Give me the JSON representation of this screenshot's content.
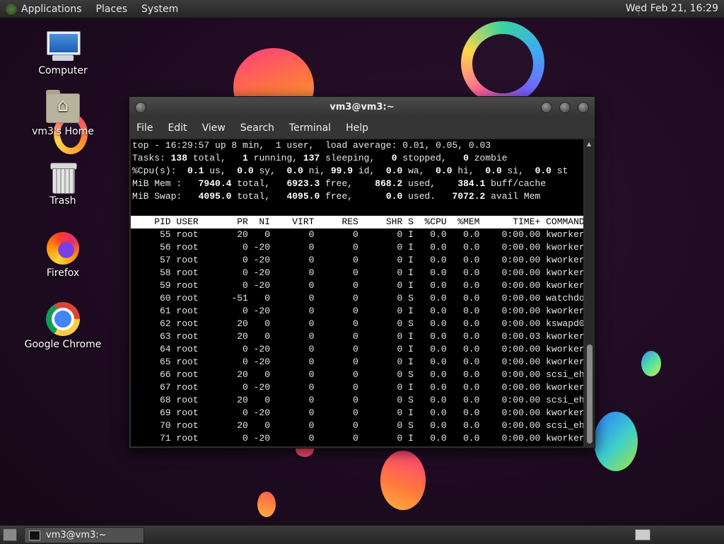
{
  "top_panel": {
    "menus": [
      "Applications",
      "Places",
      "System"
    ],
    "clock": "Wed Feb 21, 16:29"
  },
  "desktop_icons": [
    {
      "label": "Computer",
      "icon": "computer-icon"
    },
    {
      "label": "vm3's Home",
      "icon": "home-folder-icon"
    },
    {
      "label": "Trash",
      "icon": "trash-icon"
    },
    {
      "label": "Firefox",
      "icon": "firefox-icon"
    },
    {
      "label": "Google Chrome",
      "icon": "chrome-icon"
    }
  ],
  "window": {
    "title": "vm3@vm3:~",
    "menu": [
      "File",
      "Edit",
      "View",
      "Search",
      "Terminal",
      "Help"
    ]
  },
  "top": {
    "summary": [
      "top - 16:29:57 up 8 min,  1 user,  load average: 0.01, 0.05, 0.03",
      "Tasks: 138 total,   1 running, 137 sleeping,   0 stopped,   0 zombie",
      "%Cpu(s):  0.1 us,  0.0 sy,  0.0 ni, 99.9 id,  0.0 wa,  0.0 hi,  0.0 si,  0.0 st",
      "MiB Mem :   7940.4 total,   6923.3 free,    868.2 used,    384.1 buff/cache",
      "MiB Swap:   4095.0 total,   4095.0 free,      0.0 used.   7072.2 avail Mem"
    ],
    "columns": [
      "PID",
      "USER",
      "PR",
      "NI",
      "VIRT",
      "RES",
      "SHR",
      "S",
      "%CPU",
      "%MEM",
      "TIME+",
      "COMMAND"
    ],
    "processes": [
      [
        "55",
        "root",
        "20",
        "0",
        "0",
        "0",
        "0",
        "I",
        "0.0",
        "0.0",
        "0:00.00",
        "kworker+"
      ],
      [
        "56",
        "root",
        "0",
        "-20",
        "0",
        "0",
        "0",
        "I",
        "0.0",
        "0.0",
        "0:00.00",
        "kworker+"
      ],
      [
        "57",
        "root",
        "0",
        "-20",
        "0",
        "0",
        "0",
        "I",
        "0.0",
        "0.0",
        "0:00.00",
        "kworker+"
      ],
      [
        "58",
        "root",
        "0",
        "-20",
        "0",
        "0",
        "0",
        "I",
        "0.0",
        "0.0",
        "0:00.00",
        "kworker+"
      ],
      [
        "59",
        "root",
        "0",
        "-20",
        "0",
        "0",
        "0",
        "I",
        "0.0",
        "0.0",
        "0:00.00",
        "kworker+"
      ],
      [
        "60",
        "root",
        "-51",
        "0",
        "0",
        "0",
        "0",
        "S",
        "0.0",
        "0.0",
        "0:00.00",
        "watchdo+"
      ],
      [
        "61",
        "root",
        "0",
        "-20",
        "0",
        "0",
        "0",
        "I",
        "0.0",
        "0.0",
        "0:00.00",
        "kworker+"
      ],
      [
        "62",
        "root",
        "20",
        "0",
        "0",
        "0",
        "0",
        "S",
        "0.0",
        "0.0",
        "0:00.00",
        "kswapd0"
      ],
      [
        "63",
        "root",
        "20",
        "0",
        "0",
        "0",
        "0",
        "I",
        "0.0",
        "0.0",
        "0:00.03",
        "kworker+"
      ],
      [
        "64",
        "root",
        "0",
        "-20",
        "0",
        "0",
        "0",
        "I",
        "0.0",
        "0.0",
        "0:00.00",
        "kworker+"
      ],
      [
        "65",
        "root",
        "0",
        "-20",
        "0",
        "0",
        "0",
        "I",
        "0.0",
        "0.0",
        "0:00.00",
        "kworker+"
      ],
      [
        "66",
        "root",
        "20",
        "0",
        "0",
        "0",
        "0",
        "S",
        "0.0",
        "0.0",
        "0:00.00",
        "scsi_eh+"
      ],
      [
        "67",
        "root",
        "0",
        "-20",
        "0",
        "0",
        "0",
        "I",
        "0.0",
        "0.0",
        "0:00.00",
        "kworker+"
      ],
      [
        "68",
        "root",
        "20",
        "0",
        "0",
        "0",
        "0",
        "S",
        "0.0",
        "0.0",
        "0:00.00",
        "scsi_eh+"
      ],
      [
        "69",
        "root",
        "0",
        "-20",
        "0",
        "0",
        "0",
        "I",
        "0.0",
        "0.0",
        "0:00.00",
        "kworker+"
      ],
      [
        "70",
        "root",
        "20",
        "0",
        "0",
        "0",
        "0",
        "S",
        "0.0",
        "0.0",
        "0:00.00",
        "scsi_eh+"
      ],
      [
        "71",
        "root",
        "0",
        "-20",
        "0",
        "0",
        "0",
        "I",
        "0.0",
        "0.0",
        "0:00.00",
        "kworker+"
      ]
    ]
  },
  "bottom_panel": {
    "task_label": "vm3@vm3:~"
  }
}
